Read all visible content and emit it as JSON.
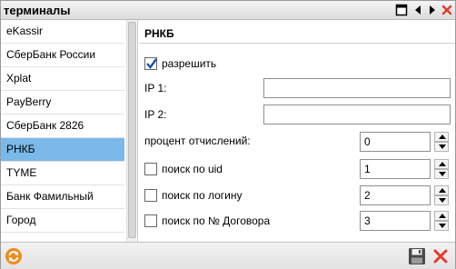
{
  "window": {
    "title": "терминалы",
    "icons": [
      "maximize-icon",
      "arrow-left-icon",
      "arrow-right-icon",
      "close-icon"
    ]
  },
  "sidebar": {
    "items": [
      {
        "label": "eKassir",
        "selected": false
      },
      {
        "label": "СберБанк России",
        "selected": false
      },
      {
        "label": "Xplat",
        "selected": false
      },
      {
        "label": "PayBerry",
        "selected": false
      },
      {
        "label": "СберБанк 2826",
        "selected": false
      },
      {
        "label": "РНКБ",
        "selected": true
      },
      {
        "label": "TYME",
        "selected": false
      },
      {
        "label": "Банк Фамильный",
        "selected": false
      },
      {
        "label": "Город",
        "selected": false
      }
    ]
  },
  "form": {
    "title": "РНКБ",
    "allow": {
      "label": "разрешить",
      "checked": true
    },
    "ip1": {
      "label": "IP 1:",
      "value": ""
    },
    "ip2": {
      "label": "IP 2:",
      "value": ""
    },
    "percent": {
      "label": "процент отчислений:",
      "value": "0"
    },
    "search_uid": {
      "label": "поиск по uid",
      "checked": false,
      "value": "1"
    },
    "search_login": {
      "label": "поиск по логину",
      "checked": false,
      "value": "2"
    },
    "search_contract": {
      "label": "поиск по № Договора",
      "checked": false,
      "value": "3"
    }
  },
  "footer": {
    "icons": [
      "refresh-icon",
      "save-icon",
      "cancel-icon"
    ]
  },
  "colors": {
    "selection": "#7ab9e8",
    "close_red": "#e23a2e",
    "refresh_orange": "#f08a1e",
    "check_blue": "#1e4fa8"
  }
}
